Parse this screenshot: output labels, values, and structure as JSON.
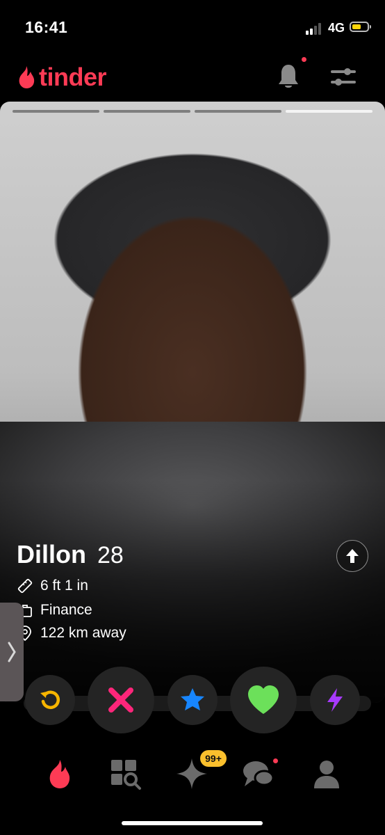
{
  "status_bar": {
    "time": "16:41",
    "network": "4G",
    "battery_level": 0.6,
    "battery_color": "#ffd60a"
  },
  "header": {
    "brand": "tinder",
    "brand_color": "#fd3b55",
    "icons": [
      "flame-icon",
      "bell-icon",
      "filter-sliders-icon"
    ]
  },
  "profile": {
    "name": "Dillon",
    "age": "28",
    "photo_count": 4,
    "active_photo": 4,
    "details": [
      {
        "icon": "ruler-icon",
        "text": "6 ft 1 in"
      },
      {
        "icon": "briefcase-icon",
        "text": "Finance"
      },
      {
        "icon": "location-pin-icon",
        "text": "122 km away"
      }
    ]
  },
  "actions": [
    {
      "name": "rewind",
      "icon": "rewind-icon",
      "color": "#f7b500"
    },
    {
      "name": "nope",
      "icon": "x-icon",
      "color": "#fd267a"
    },
    {
      "name": "super-like",
      "icon": "star-icon",
      "color": "#1786ff"
    },
    {
      "name": "like",
      "icon": "heart-icon",
      "color": "#6ce05a"
    },
    {
      "name": "boost",
      "icon": "lightning-icon",
      "color": "#a83aff"
    }
  ],
  "nav": {
    "items": [
      "flame-icon",
      "explore-icon",
      "sparkle-icon",
      "chat-icon",
      "profile-icon"
    ],
    "badge": "99+"
  }
}
